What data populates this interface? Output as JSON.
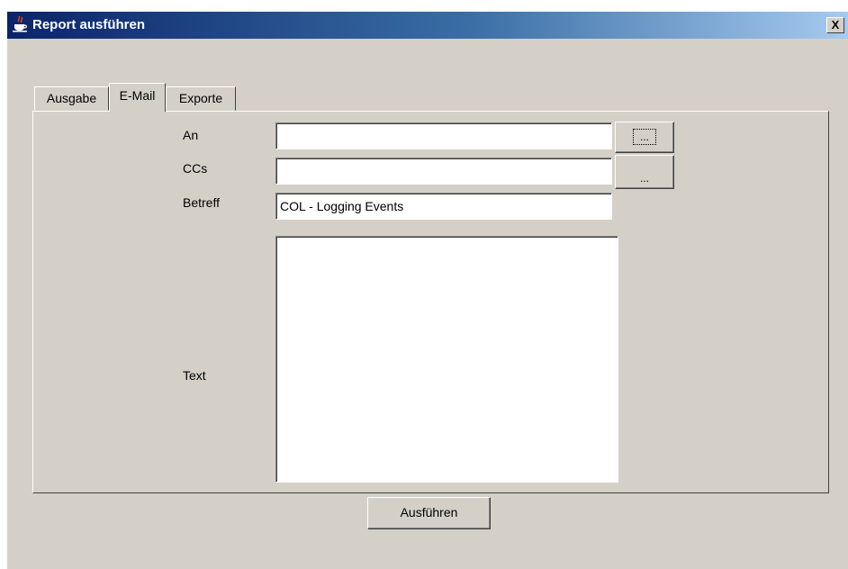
{
  "window": {
    "title": "Report ausführen",
    "close_glyph": "X",
    "app_icon": "java-cup-icon"
  },
  "tabs": [
    {
      "label": "Ausgabe",
      "active": false
    },
    {
      "label": "E-Mail",
      "active": true
    },
    {
      "label": "Exporte",
      "active": false
    }
  ],
  "email_form": {
    "to_label": "An",
    "to_value": "",
    "to_browse": "...",
    "cc_label": "CCs",
    "cc_value": "",
    "cc_browse": "...",
    "subject_label": "Betreff",
    "subject_value": "COL - Logging Events",
    "text_label": "Text",
    "text_value": ""
  },
  "actions": {
    "run_label": "Ausführen"
  },
  "colors": {
    "titlebar_start": "#0a246a",
    "titlebar_end": "#a6caf0",
    "dialog_bg": "#d4d0c8"
  }
}
